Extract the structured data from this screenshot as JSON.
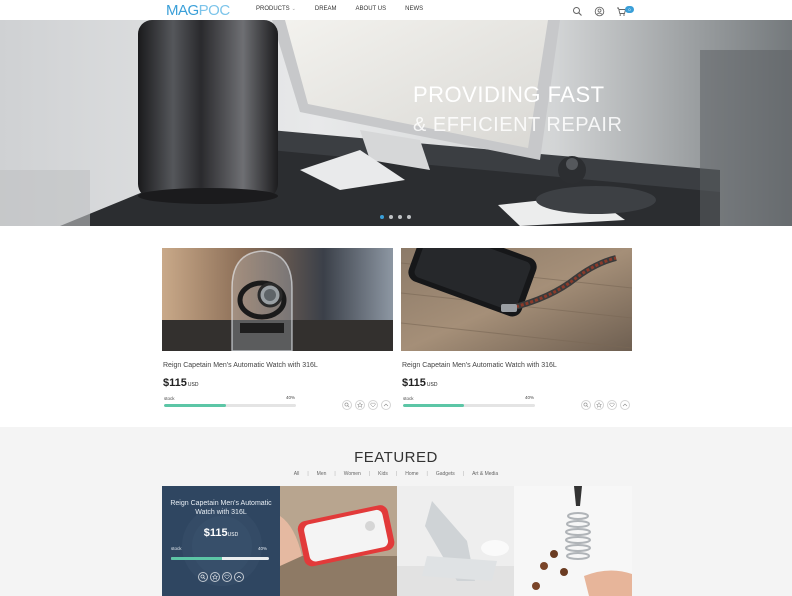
{
  "nav": {
    "logo_part1": "MAG",
    "logo_part2": "POC",
    "menu": [
      "PRODUCTS",
      "DREAM",
      "ABOUT US",
      "NEWS"
    ],
    "cart_count": "0"
  },
  "hero": {
    "line1": "PROVIDING FAST",
    "line2": "& EFFICIENT REPAIR",
    "slides": 4,
    "active_slide": 1
  },
  "products": [
    {
      "title": "Reign Capetain Men's Automatic Watch with 316L",
      "price": "$115",
      "currency": "USD",
      "stock_label": "stock",
      "stock_percent_text": "40%",
      "stock_fraction": 0.47
    },
    {
      "title": "Reign Capetain Men's Automatic Watch with 316L",
      "price": "$115",
      "currency": "USD",
      "stock_label": "stock",
      "stock_percent_text": "40%",
      "stock_fraction": 0.46
    }
  ],
  "featured": {
    "title": "FEATURED",
    "filters": [
      "All",
      "Men",
      "Women",
      "Kids",
      "Home",
      "Gadgets",
      "Art & Media"
    ],
    "overlay": {
      "title": "Reign Capetain Men's Automatic Watch with 316L",
      "price": "$115",
      "currency": "USD",
      "stock_label": "stock",
      "stock_percent_text": "40%",
      "stock_fraction": 0.52
    }
  },
  "colors": {
    "accent": "#3a9fd8",
    "stock_fill": "#5cc6a6",
    "overlay": "#28405c"
  },
  "icons": [
    "search-icon",
    "user-icon",
    "cart-icon",
    "zoom-icon",
    "star-icon",
    "heart-icon",
    "up-arrow-icon"
  ]
}
